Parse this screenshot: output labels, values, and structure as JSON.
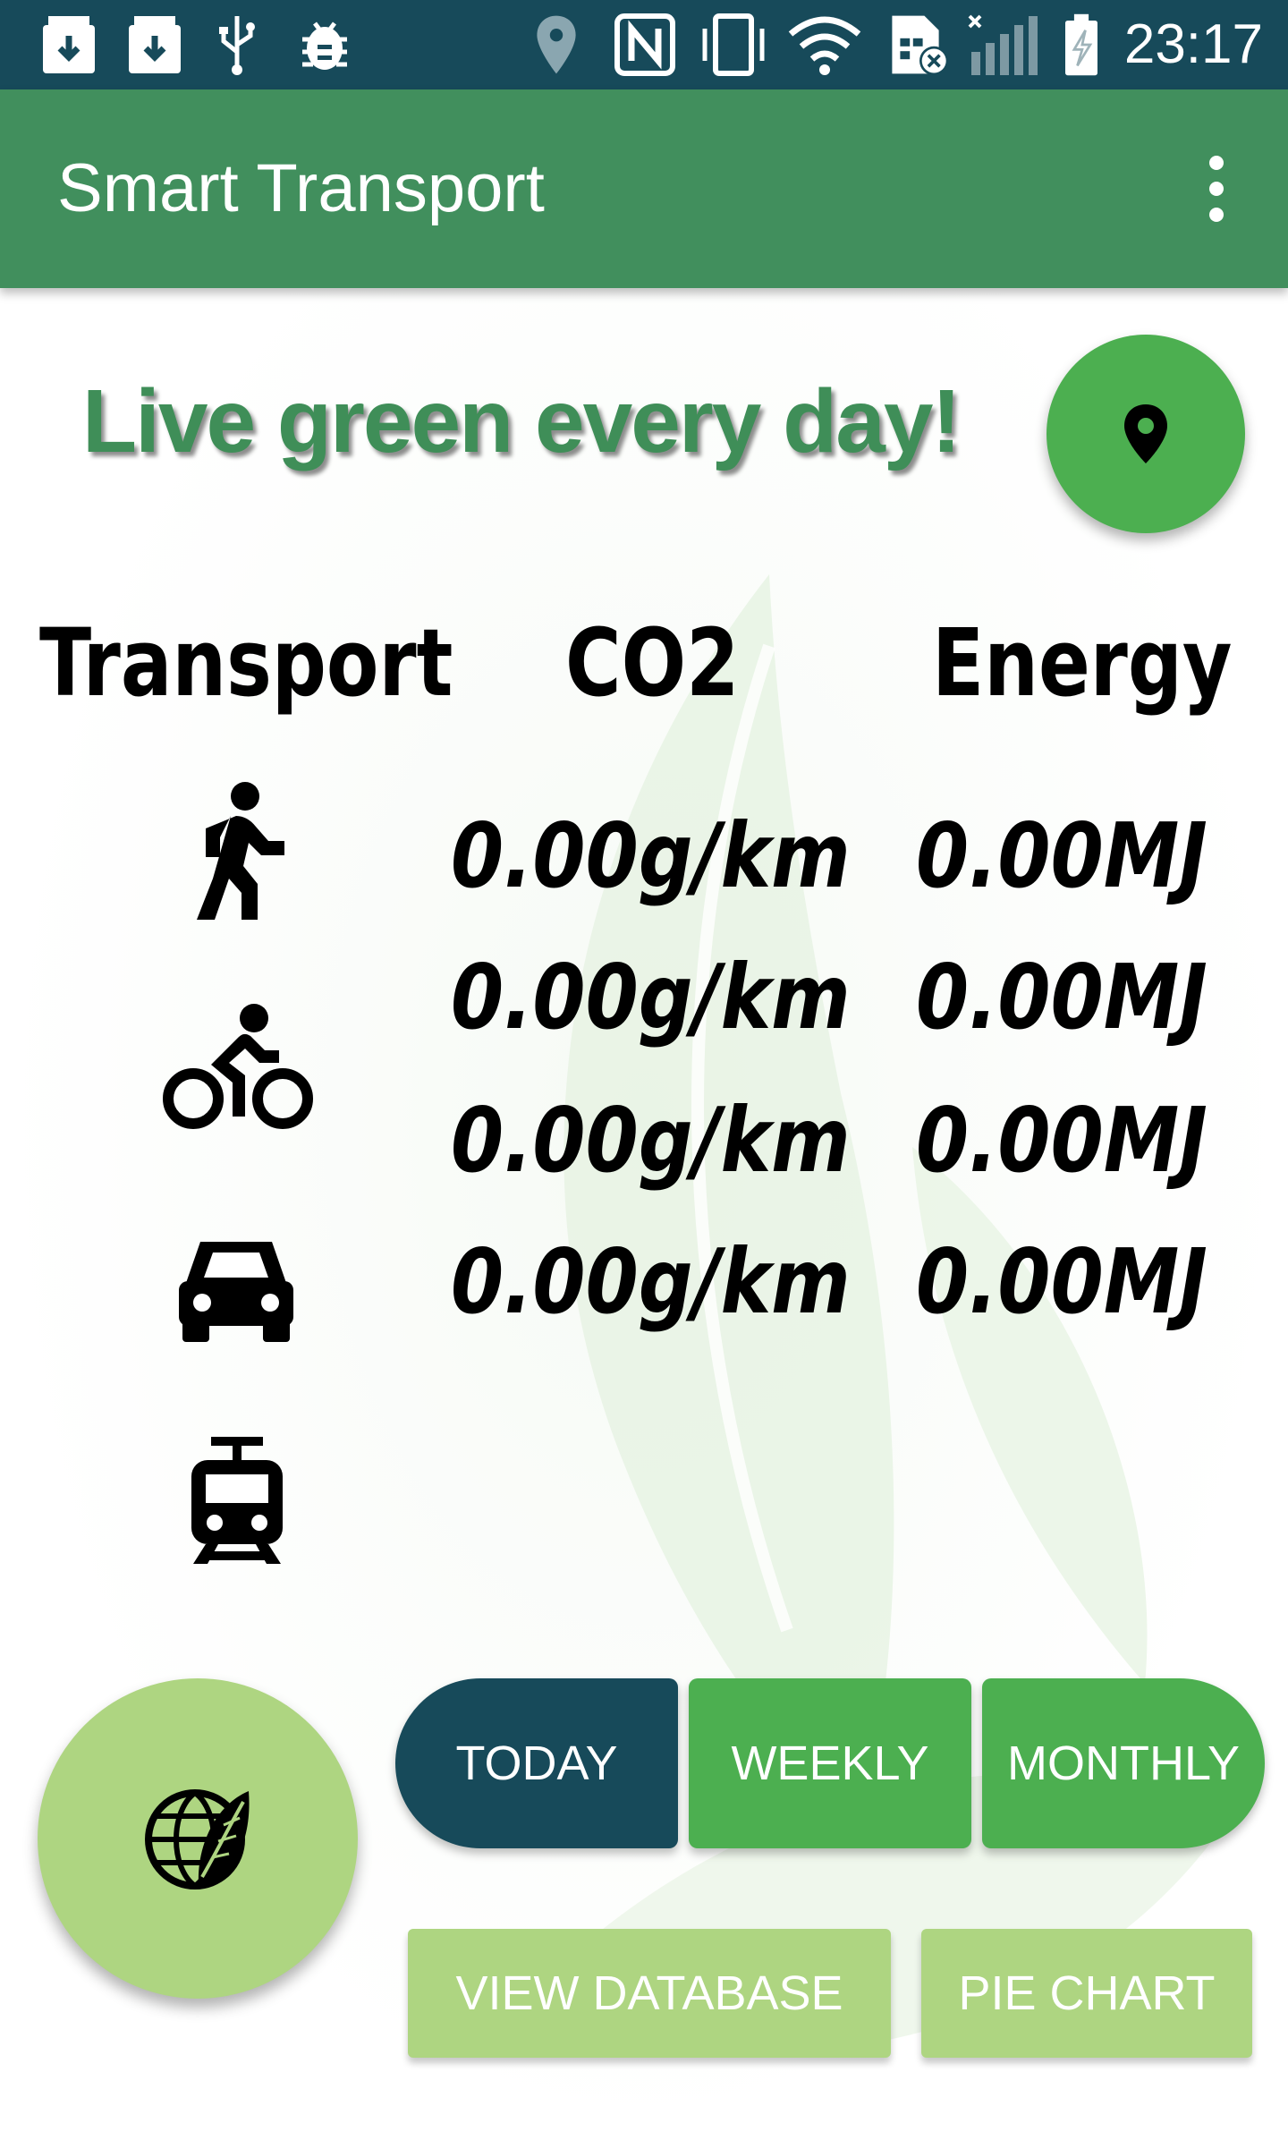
{
  "status_bar": {
    "time": "23:17",
    "left_icons": [
      "download-box-icon",
      "download-box-icon",
      "usb-icon",
      "android-debug-icon"
    ],
    "right_icons": [
      "location-icon",
      "nfc-icon",
      "vibrate-icon",
      "wifi-icon",
      "no-sim-icon",
      "signal-icon",
      "battery-charging-icon"
    ]
  },
  "app_bar": {
    "title": "Smart Transport",
    "overflow_icon": "more-vert-icon",
    "color": "#418f5d"
  },
  "main": {
    "slogan": "Live green every day!",
    "location_button_icon": "place-icon",
    "table": {
      "headers": [
        "Transport",
        "CO2",
        "Energy"
      ],
      "rows": [
        {
          "icon": "walk-icon",
          "co2": "0.00g/km",
          "energy": "0.00MJ"
        },
        {
          "icon": "bike-icon",
          "co2": "0.00g/km",
          "energy": "0.00MJ"
        },
        {
          "icon": "car-icon",
          "co2": "0.00g/km",
          "energy": "0.00MJ"
        },
        {
          "icon": "tram-icon",
          "co2": "0.00g/km",
          "energy": "0.00MJ"
        }
      ]
    },
    "eco_button_icon": "globe-leaf-icon",
    "period_tabs": [
      "TODAY",
      "WEEKLY",
      "MONTHLY"
    ],
    "selected_period": "TODAY",
    "buttons": {
      "view_database": "VIEW DATABASE",
      "pie_chart": "PIE CHART"
    }
  },
  "colors": {
    "status_bar": "#174a5a",
    "accent_green": "#4caf50",
    "light_green": "#aed581",
    "selected_tab": "#174a5a",
    "slogan_text": "#3f8e58"
  }
}
